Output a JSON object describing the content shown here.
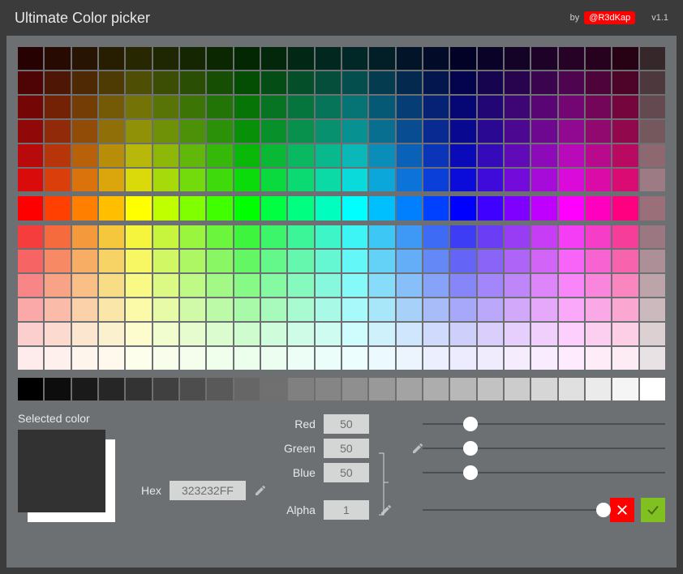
{
  "header": {
    "title": "Ultimate Color picker",
    "by_label": "by",
    "author": "@R3dKap",
    "version": "v1.1"
  },
  "palette": {
    "hues_deg": [
      0,
      15,
      30,
      45,
      60,
      75,
      90,
      105,
      120,
      135,
      150,
      165,
      180,
      195,
      210,
      225,
      240,
      255,
      270,
      285,
      300,
      315,
      330,
      345
    ],
    "shade_lightness_pct": [
      8,
      16,
      24,
      30,
      38,
      45
    ],
    "tint_lightness_pct": [
      60,
      68,
      75,
      82,
      90,
      96
    ],
    "grays_lightness_pct": [
      0,
      5,
      10,
      15,
      20,
      25,
      30,
      35,
      40,
      44,
      50,
      52,
      56,
      60,
      64,
      68,
      72,
      76,
      80,
      84,
      88,
      92,
      96,
      100
    ]
  },
  "selected": {
    "label": "Selected color",
    "hex_label": "Hex",
    "hex_value": "323232FF",
    "preview": "#323232"
  },
  "rgb": {
    "red_label": "Red",
    "green_label": "Green",
    "blue_label": "Blue",
    "red_value": "50",
    "green_value": "50",
    "blue_value": "50",
    "slider_pct": 19.6
  },
  "alpha": {
    "label": "Alpha",
    "value": "1",
    "slider_pct": 100
  }
}
